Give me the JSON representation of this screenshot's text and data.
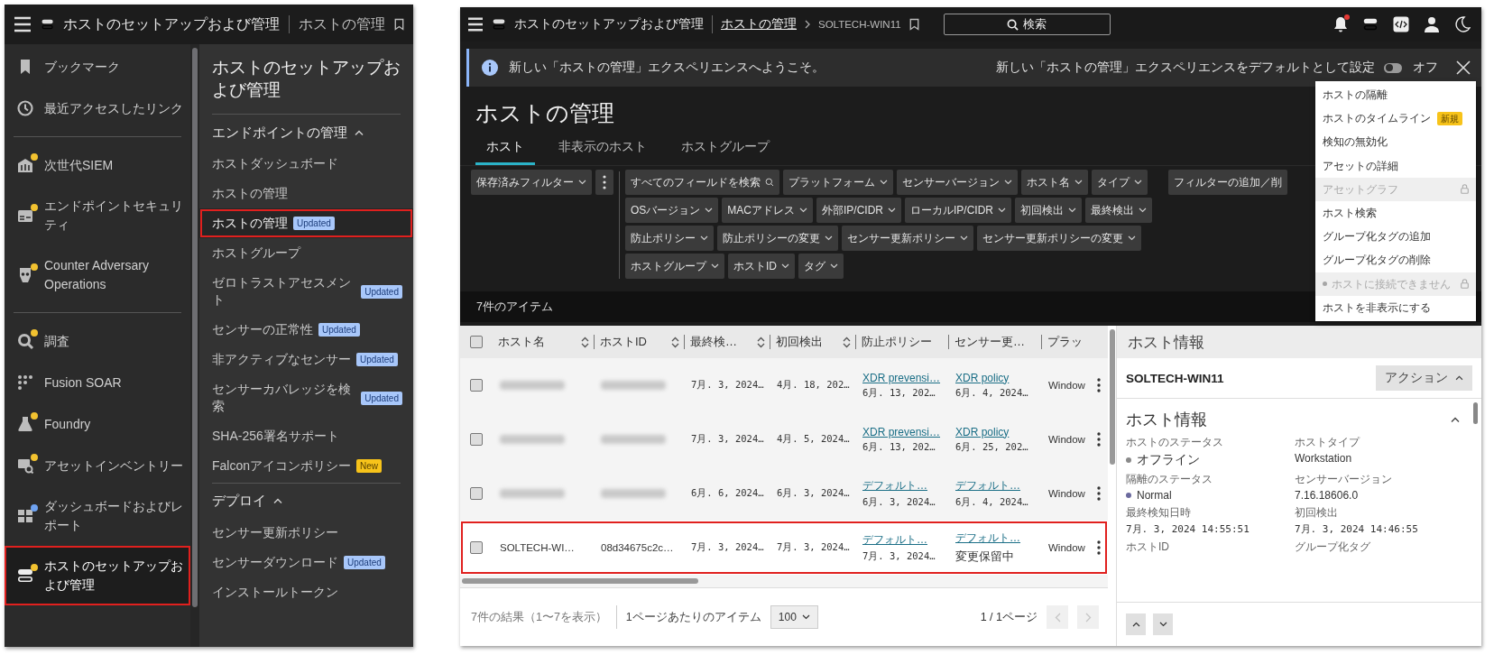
{
  "left_screen": {
    "app_bar": {
      "title": "ホストのセットアップおよび管理",
      "page": "ホストの管理"
    },
    "nav_groups": [
      {
        "items": [
          {
            "label": "ブックマーク",
            "selected": false,
            "highlighted": false
          },
          {
            "label": "最近アクセスしたリンク",
            "selected": false,
            "highlighted": false
          }
        ]
      },
      {
        "items": [
          {
            "label": "次世代SIEM",
            "color": "#f2c230",
            "selected": false,
            "highlighted": false
          },
          {
            "label": "エンドポイントセキュリティ",
            "color": "#f2c230",
            "selected": false,
            "highlighted": false
          },
          {
            "label": "Counter Adversary Operations",
            "color": "#f2c230",
            "selected": false,
            "highlighted": false
          }
        ]
      },
      {
        "items": [
          {
            "label": "調査",
            "color": "#f2c230",
            "selected": false,
            "highlighted": false
          },
          {
            "label": "Fusion SOAR",
            "selected": false,
            "highlighted": false
          },
          {
            "label": "Foundry",
            "color": "#f2c230",
            "selected": false,
            "highlighted": false
          },
          {
            "label": "アセットインベントリー",
            "color": "#f2c230",
            "selected": false,
            "highlighted": false
          },
          {
            "label": "ダッシュボードおよびレポート",
            "color": "#6fa3f2",
            "selected": false,
            "highlighted": false
          },
          {
            "label": "ホストのセットアップおよび管理",
            "color": "#f2c230",
            "selected": true,
            "highlighted": true
          }
        ]
      }
    ],
    "submenu": {
      "title": "ホストのセットアップおよび管理",
      "sections": [
        {
          "title": "エンドポイントの管理",
          "expanded": true,
          "items": [
            {
              "label": "ホストダッシュボード",
              "selected": false,
              "highlighted": false
            },
            {
              "label": "ホストの管理",
              "selected": false,
              "highlighted": false
            },
            {
              "label": "ホストの管理",
              "badge": {
                "text": "Updated",
                "kind": "updated"
              },
              "selected": true,
              "highlighted": true
            },
            {
              "label": "ホストグループ",
              "selected": false,
              "highlighted": false
            },
            {
              "label": "ゼロトラストアセスメント",
              "badge": {
                "text": "Updated",
                "kind": "updated"
              },
              "selected": false,
              "highlighted": false
            },
            {
              "label": "センサーの正常性",
              "badge": {
                "text": "Updated",
                "kind": "updated"
              },
              "selected": false,
              "highlighted": false
            },
            {
              "label": "非アクティブなセンサー",
              "badge": {
                "text": "Updated",
                "kind": "updated"
              },
              "selected": false,
              "highlighted": false
            },
            {
              "label": "センサーカバレッジを検索",
              "badge": {
                "text": "Updated",
                "kind": "updated"
              },
              "selected": false,
              "highlighted": false
            },
            {
              "label": "SHA-256署名サポート",
              "selected": false,
              "highlighted": false
            },
            {
              "label": "Falconアイコンポリシー",
              "badge": {
                "text": "New",
                "kind": "new"
              },
              "selected": false,
              "highlighted": false
            }
          ]
        },
        {
          "title": "デプロイ",
          "expanded": true,
          "items": [
            {
              "label": "センサー更新ポリシー",
              "selected": false,
              "highlighted": false
            },
            {
              "label": "センサーダウンロード",
              "badge": {
                "text": "Updated",
                "kind": "updated"
              },
              "selected": false,
              "highlighted": false
            },
            {
              "label": "インストールトークン",
              "selected": false,
              "highlighted": false
            }
          ]
        }
      ]
    }
  },
  "right_screen": {
    "top_bar": {
      "title": "ホストのセットアップおよび管理",
      "breadcrumb_link": "ホストの管理",
      "breadcrumb_current": "SOLTECH-WIN11",
      "search_label": "検索",
      "has_notification": true
    },
    "banner": {
      "message": "新しい「ホストの管理」エクスペリエンスへようこそ。",
      "setting_label": "新しい「ホストの管理」エクスペリエンスをデフォルトとして設定",
      "toggle_on": false,
      "toggle_label": "オフ"
    },
    "page_title": "ホストの管理",
    "tabs": [
      {
        "label": "ホスト",
        "selected": true
      },
      {
        "label": "非表示のホスト",
        "selected": false
      },
      {
        "label": "ホストグループ",
        "selected": false
      }
    ],
    "saved_filter": "保存済みフィルター",
    "filter_rows": [
      [
        {
          "label": "すべてのフィールドを検索",
          "kind": "search"
        },
        {
          "label": "プラットフォーム",
          "kind": "dropdown"
        },
        {
          "label": "センサーバージョン",
          "kind": "dropdown"
        },
        {
          "label": "ホスト名",
          "kind": "dropdown"
        },
        {
          "label": "タイプ",
          "kind": "dropdown"
        }
      ],
      [
        {
          "label": "OSバージョン",
          "kind": "dropdown"
        },
        {
          "label": "MACアドレス",
          "kind": "dropdown"
        },
        {
          "label": "外部IP/CIDR",
          "kind": "dropdown"
        },
        {
          "label": "ローカルIP/CIDR",
          "kind": "dropdown"
        },
        {
          "label": "初回検出",
          "kind": "dropdown"
        },
        {
          "label": "最終検出",
          "kind": "dropdown"
        }
      ],
      [
        {
          "label": "防止ポリシー",
          "kind": "dropdown"
        },
        {
          "label": "防止ポリシーの変更",
          "kind": "dropdown"
        },
        {
          "label": "センサー更新ポリシー",
          "kind": "dropdown"
        },
        {
          "label": "センサー更新ポリシーの変更",
          "kind": "dropdown"
        }
      ],
      [
        {
          "label": "ホストグループ",
          "kind": "dropdown"
        },
        {
          "label": "ホストID",
          "kind": "dropdown"
        },
        {
          "label": "タグ",
          "kind": "dropdown"
        }
      ]
    ],
    "add_filter": "フィルターの追加／削",
    "item_count": "7件のアイテム",
    "table": {
      "select_all_checked": false,
      "columns": [
        {
          "label": "ホスト名",
          "sortable": true
        },
        {
          "label": "ホストID",
          "sortable": true
        },
        {
          "label": "最終検…",
          "sortable": true
        },
        {
          "label": "初回検出",
          "sortable": true
        },
        {
          "label": "防止ポリシー",
          "sortable": false
        },
        {
          "label": "センサー更…",
          "sortable": false
        },
        {
          "label": "プラッ",
          "sortable": false
        }
      ],
      "rows": [
        {
          "checked": false,
          "highlighted": false,
          "redacted": true,
          "last_seen": "7月. 3, 2024…",
          "first_seen": "4月. 18, 202…",
          "prevention_policy": {
            "link": "XDR prevensi…",
            "date": "6月. 13, 202…"
          },
          "sensor_policy": {
            "link": "XDR policy",
            "date": "6月. 4, 2024…"
          },
          "platform": "Window"
        },
        {
          "checked": false,
          "highlighted": false,
          "redacted": true,
          "last_seen": "7月. 3, 2024…",
          "first_seen": "4月. 5, 2024…",
          "prevention_policy": {
            "link": "XDR prevensi…",
            "date": "6月. 13, 202…"
          },
          "sensor_policy": {
            "link": "XDR policy",
            "date": "6月. 25, 202…"
          },
          "platform": "Window"
        },
        {
          "checked": false,
          "highlighted": false,
          "redacted": true,
          "last_seen": "6月. 6, 2024…",
          "first_seen": "6月. 3, 2024…",
          "prevention_policy": {
            "link": "デフォルト…",
            "date": "6月. 3, 2024…"
          },
          "sensor_policy": {
            "link": "デフォルト…",
            "date": "6月. 4, 2024…"
          },
          "platform": "Window"
        },
        {
          "checked": false,
          "highlighted": true,
          "redacted": false,
          "host_name": "SOLTECH-WI…",
          "host_id": "08d34675c2c…",
          "last_seen": "7月. 3, 2024…",
          "first_seen": "7月. 3, 2024…",
          "prevention_policy": {
            "link": "デフォルト…",
            "date": "7月. 3, 2024…"
          },
          "sensor_policy": {
            "link": "デフォルト…",
            "status": "変更保留中"
          },
          "platform": "Window"
        }
      ]
    },
    "footer": {
      "results": "7件の結果（1〜7を表示）",
      "per_page_label": "1ページあたりのアイテム",
      "per_page": "100",
      "page": "1 / 1ページ",
      "prev_disabled": true,
      "next_disabled": true
    },
    "details": {
      "header": "ホスト情報",
      "host": "SOLTECH-WIN11",
      "actions_label": "アクション",
      "actions_expanded": true,
      "section_title": "ホスト情報",
      "section_expanded": true,
      "fields": [
        {
          "label": "ホストのステータス",
          "value": "オフライン",
          "color": "#8a8a8a"
        },
        {
          "label": "ホストタイプ",
          "value": "Workstation"
        },
        {
          "label": "隔離のステータス",
          "value": "Normal",
          "color": "#6b6a9e"
        },
        {
          "label": "センサーバージョン",
          "value": "7.16.18606.0"
        },
        {
          "label": "最終検知日時",
          "value": "7月. 3, 2024 14:55:51",
          "kind": "date"
        },
        {
          "label": "初回検出",
          "value": "7月. 3, 2024 14:46:55",
          "kind": "date"
        },
        {
          "label": "ホストID"
        },
        {
          "label": "グループ化タグ"
        }
      ]
    },
    "action_menu": [
      {
        "label": "ホストの隔離",
        "disabled": false
      },
      {
        "label": "ホストのタイムライン",
        "badge": "新規",
        "disabled": false
      },
      {
        "label": "検知の無効化",
        "disabled": false
      },
      {
        "label": "アセットの詳細",
        "disabled": false
      },
      {
        "label": "アセットグラフ",
        "disabled": true
      },
      {
        "label": "ホスト検索",
        "disabled": false
      },
      {
        "label": "グループ化タグの追加",
        "disabled": false
      },
      {
        "label": "グループ化タグの削除",
        "disabled": false
      },
      {
        "label": "ホストに接続できません",
        "color": "#a6a6a6",
        "disabled": true
      },
      {
        "label": "ホストを非表示にする",
        "disabled": false
      }
    ]
  }
}
